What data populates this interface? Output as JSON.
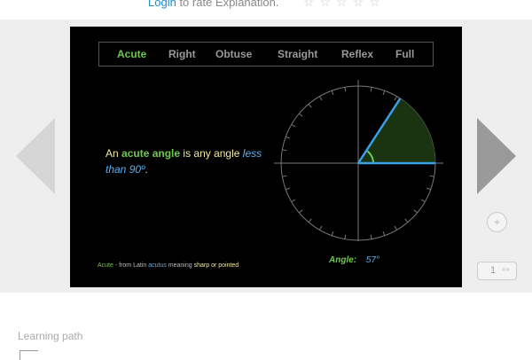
{
  "rating": {
    "login_label": "Login",
    "rate_text": "to rate Explanation.",
    "stars": "☆☆☆☆☆"
  },
  "tabs": [
    "Acute",
    "Right",
    "Obtuse",
    "Straight",
    "Reflex",
    "Full"
  ],
  "active_tab": "Acute",
  "description": {
    "prefix": "An",
    "term": "acute angle",
    "middle": "is any angle",
    "condition": "less than 90º",
    "end": "."
  },
  "footnote": {
    "word": "Acute",
    "from": "- from Latin",
    "latin": "acutus",
    "meaning_label": "meaning",
    "meaning": "sharp or pointed"
  },
  "angle_readout": {
    "label": "Angle:",
    "value": "57°"
  },
  "angle_degrees": 57,
  "pagination": {
    "page": "1",
    "arrows": "»»"
  },
  "learning_path": {
    "label": "Learning path"
  },
  "colors": {
    "acute_green": "#6ec94c",
    "ray_blue": "#3aa0e6",
    "text_yellow": "#f2e9a0",
    "arrow_grey": "#9a9a9a"
  },
  "icons": {
    "prev": "arrow-left-icon",
    "next": "arrow-right-icon",
    "locate": "crosshair-icon",
    "learning": "path-icon"
  }
}
